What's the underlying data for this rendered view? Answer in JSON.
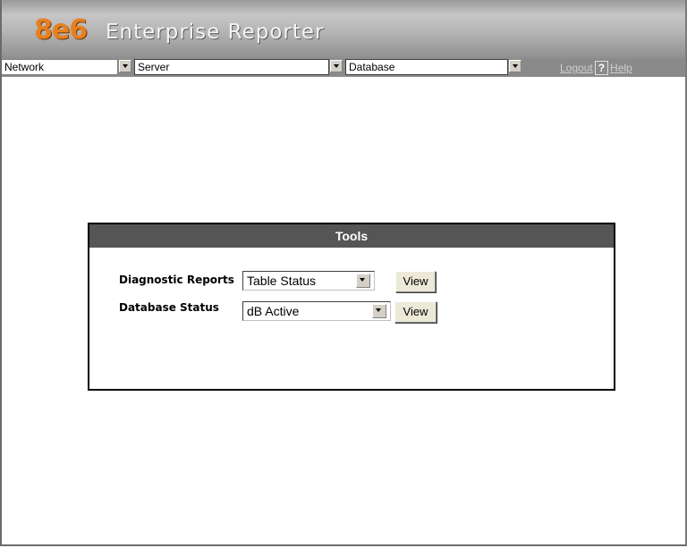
{
  "app": {
    "logo": "8e6",
    "title": "Enterprise Reporter"
  },
  "nav": {
    "network": "Network",
    "server": "Server",
    "database": "Database",
    "logout": "Logout",
    "help_icon": "?",
    "help": "Help"
  },
  "tools": {
    "title": "Tools",
    "rows": [
      {
        "label": "Diagnostic Reports",
        "value": "Table Status",
        "button": "View"
      },
      {
        "label": "Database Status",
        "value": "dB Active",
        "button": "View"
      }
    ]
  },
  "colors": {
    "logo": "#e8801f",
    "panel_header": "#555555"
  }
}
